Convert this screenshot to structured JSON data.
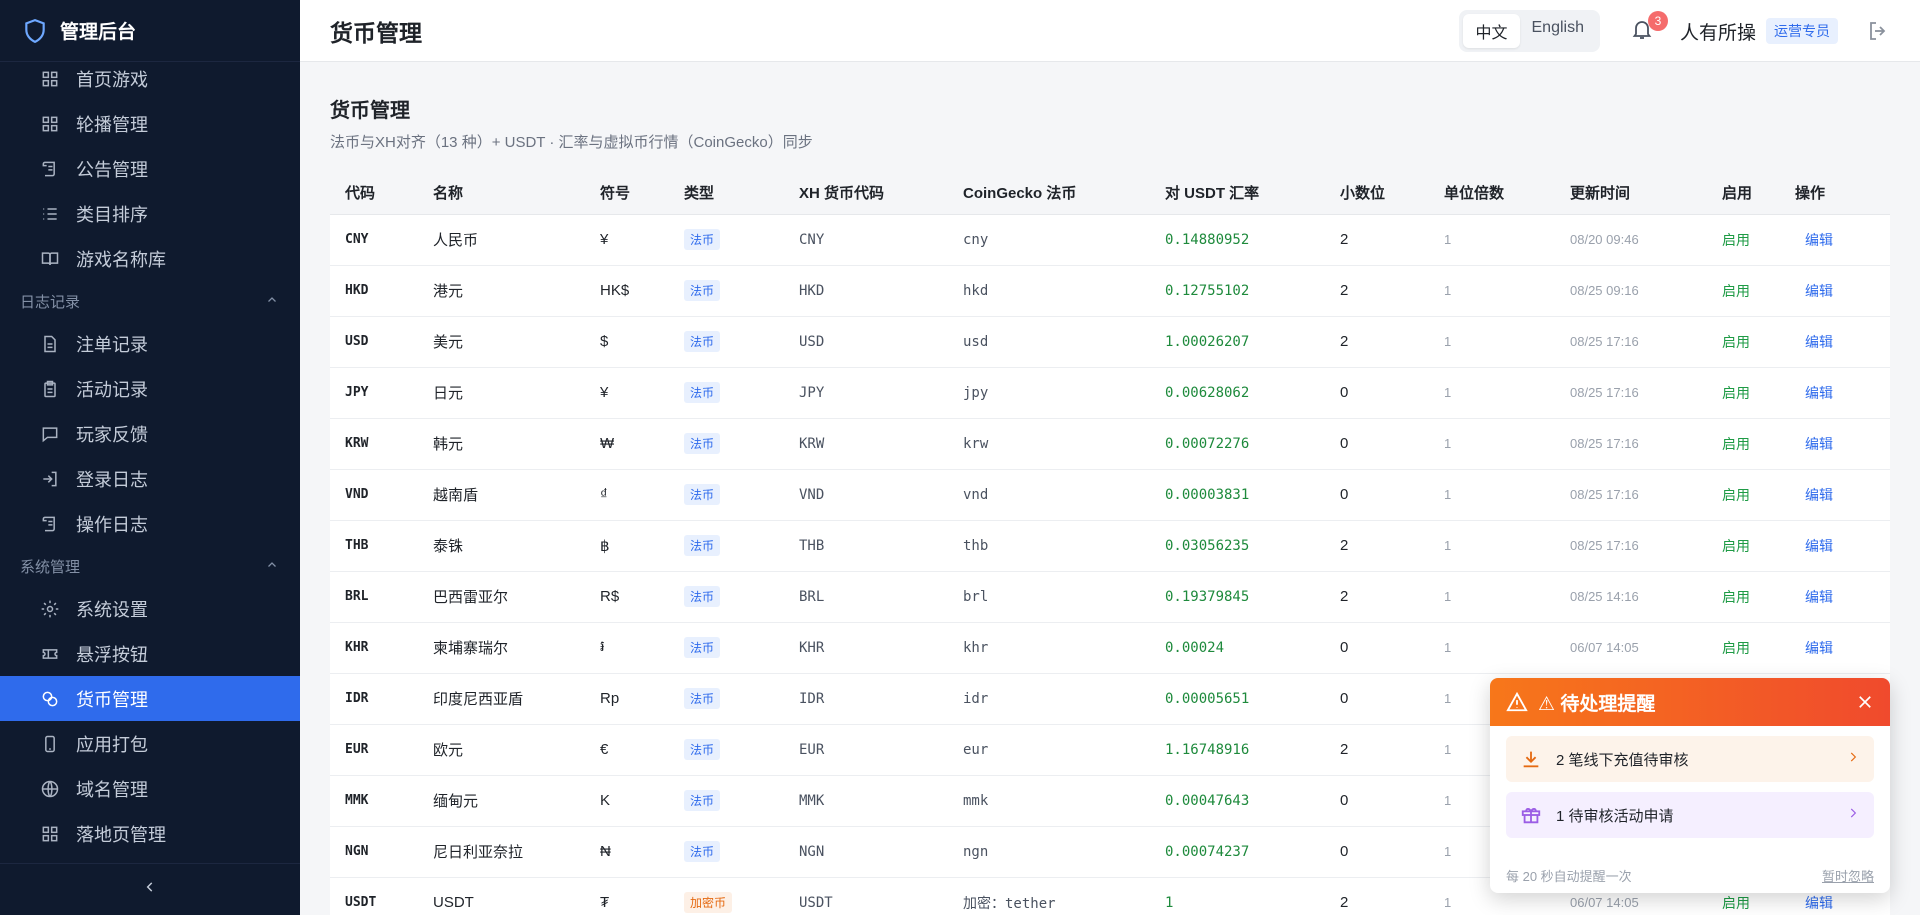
{
  "brand": {
    "title": "管理后台"
  },
  "header": {
    "title": "货币管理"
  },
  "lang": {
    "zh": "中文",
    "en": "English"
  },
  "notifications": {
    "count": "3"
  },
  "user": {
    "name": "人有所操",
    "role": "运营专员"
  },
  "sidebar": {
    "items_top": [
      {
        "label": "首页游戏",
        "icon": "grid-icon"
      },
      {
        "label": "轮播管理",
        "icon": "grid-icon"
      },
      {
        "label": "公告管理",
        "icon": "scroll-icon"
      },
      {
        "label": "类目排序",
        "icon": "list-icon"
      },
      {
        "label": "游戏名称库",
        "icon": "book-icon"
      }
    ],
    "section_logs": "日志记录",
    "items_logs": [
      {
        "label": "注单记录",
        "icon": "document-icon"
      },
      {
        "label": "活动记录",
        "icon": "clipboard-icon"
      },
      {
        "label": "玩家反馈",
        "icon": "message-icon"
      },
      {
        "label": "登录日志",
        "icon": "login-icon"
      },
      {
        "label": "操作日志",
        "icon": "scroll-icon"
      }
    ],
    "section_system": "系统管理",
    "items_system": [
      {
        "label": "系统设置",
        "icon": "gear-icon"
      },
      {
        "label": "悬浮按钮",
        "icon": "ticket-icon"
      },
      {
        "label": "货币管理",
        "icon": "coins-icon"
      },
      {
        "label": "应用打包",
        "icon": "phone-icon"
      },
      {
        "label": "域名管理",
        "icon": "globe-icon"
      },
      {
        "label": "落地页管理",
        "icon": "grid-icon"
      }
    ]
  },
  "main": {
    "title": "货币管理",
    "subtitle": "法币与XH对齐（13 种）+ USDT · 汇率与虚拟币行情（CoinGecko）同步",
    "columns": [
      "代码",
      "名称",
      "符号",
      "类型",
      "XH 货币代码",
      "CoinGecko 法币",
      "对 USDT 汇率",
      "小数位",
      "单位倍数",
      "更新时间",
      "启用",
      "操作"
    ],
    "rows": [
      {
        "code": "CNY",
        "name": "人民币",
        "symbol": "¥",
        "type": "法币",
        "kind": "fiat",
        "xh": "CNY",
        "cg": "cny",
        "rate": "0.14880952",
        "decimals": "2",
        "multiplier": "1",
        "updated": "08/20 09:46",
        "enabled": "启用",
        "action": "编辑"
      },
      {
        "code": "HKD",
        "name": "港元",
        "symbol": "HK$",
        "type": "法币",
        "kind": "fiat",
        "xh": "HKD",
        "cg": "hkd",
        "rate": "0.12755102",
        "decimals": "2",
        "multiplier": "1",
        "updated": "08/25 09:16",
        "enabled": "启用",
        "action": "编辑"
      },
      {
        "code": "USD",
        "name": "美元",
        "symbol": "$",
        "type": "法币",
        "kind": "fiat",
        "xh": "USD",
        "cg": "usd",
        "rate": "1.00026207",
        "decimals": "2",
        "multiplier": "1",
        "updated": "08/25 17:16",
        "enabled": "启用",
        "action": "编辑"
      },
      {
        "code": "JPY",
        "name": "日元",
        "symbol": "¥",
        "type": "法币",
        "kind": "fiat",
        "xh": "JPY",
        "cg": "jpy",
        "rate": "0.00628062",
        "decimals": "0",
        "multiplier": "1",
        "updated": "08/25 17:16",
        "enabled": "启用",
        "action": "编辑"
      },
      {
        "code": "KRW",
        "name": "韩元",
        "symbol": "₩",
        "type": "法币",
        "kind": "fiat",
        "xh": "KRW",
        "cg": "krw",
        "rate": "0.00072276",
        "decimals": "0",
        "multiplier": "1",
        "updated": "08/25 17:16",
        "enabled": "启用",
        "action": "编辑"
      },
      {
        "code": "VND",
        "name": "越南盾",
        "symbol": "₫",
        "type": "法币",
        "kind": "fiat",
        "xh": "VND",
        "cg": "vnd",
        "rate": "0.00003831",
        "decimals": "0",
        "multiplier": "1",
        "updated": "08/25 17:16",
        "enabled": "启用",
        "action": "编辑"
      },
      {
        "code": "THB",
        "name": "泰铢",
        "symbol": "฿",
        "type": "法币",
        "kind": "fiat",
        "xh": "THB",
        "cg": "thb",
        "rate": "0.03056235",
        "decimals": "2",
        "multiplier": "1",
        "updated": "08/25 17:16",
        "enabled": "启用",
        "action": "编辑"
      },
      {
        "code": "BRL",
        "name": "巴西雷亚尔",
        "symbol": "R$",
        "type": "法币",
        "kind": "fiat",
        "xh": "BRL",
        "cg": "brl",
        "rate": "0.19379845",
        "decimals": "2",
        "multiplier": "1",
        "updated": "08/25 14:16",
        "enabled": "启用",
        "action": "编辑"
      },
      {
        "code": "KHR",
        "name": "柬埔寨瑞尔",
        "symbol": "៛",
        "type": "法币",
        "kind": "fiat",
        "xh": "KHR",
        "cg": "khr",
        "rate": "0.00024",
        "decimals": "0",
        "multiplier": "1",
        "updated": "06/07 14:05",
        "enabled": "启用",
        "action": "编辑"
      },
      {
        "code": "IDR",
        "name": "印度尼西亚盾",
        "symbol": "Rp",
        "type": "法币",
        "kind": "fiat",
        "xh": "IDR",
        "cg": "idr",
        "rate": "0.00005651",
        "decimals": "0",
        "multiplier": "1",
        "updated": "",
        "enabled": "",
        "action": ""
      },
      {
        "code": "EUR",
        "name": "欧元",
        "symbol": "€",
        "type": "法币",
        "kind": "fiat",
        "xh": "EUR",
        "cg": "eur",
        "rate": "1.16748916",
        "decimals": "2",
        "multiplier": "1",
        "updated": "",
        "enabled": "",
        "action": ""
      },
      {
        "code": "MMK",
        "name": "缅甸元",
        "symbol": "K",
        "type": "法币",
        "kind": "fiat",
        "xh": "MMK",
        "cg": "mmk",
        "rate": "0.00047643",
        "decimals": "0",
        "multiplier": "1",
        "updated": "",
        "enabled": "",
        "action": ""
      },
      {
        "code": "NGN",
        "name": "尼日利亚奈拉",
        "symbol": "₦",
        "type": "法币",
        "kind": "fiat",
        "xh": "NGN",
        "cg": "ngn",
        "rate": "0.00074237",
        "decimals": "0",
        "multiplier": "1",
        "updated": "",
        "enabled": "",
        "action": ""
      },
      {
        "code": "USDT",
        "name": "USDT",
        "symbol": "₮",
        "type": "加密币",
        "kind": "crypto",
        "xh": "USDT",
        "cg": "加密：tether",
        "rate": "1",
        "decimals": "2",
        "multiplier": "1",
        "updated": "06/07 14:05",
        "enabled": "启用",
        "action": "编辑"
      }
    ]
  },
  "popup": {
    "title": "待处理提醒",
    "items": [
      {
        "text": "2 笔线下充值待审核",
        "icon": "download-icon"
      },
      {
        "text": "1 待审核活动申请",
        "icon": "gift-icon"
      }
    ],
    "footer_note": "每 20 秒自动提醒一次",
    "snooze": "暂时忽略"
  },
  "colors": {
    "sidebar_bg": "#0f1a2e",
    "active": "#2f6bec",
    "rate_green": "#1e8a3c",
    "popup_orange": "#f7771a"
  }
}
